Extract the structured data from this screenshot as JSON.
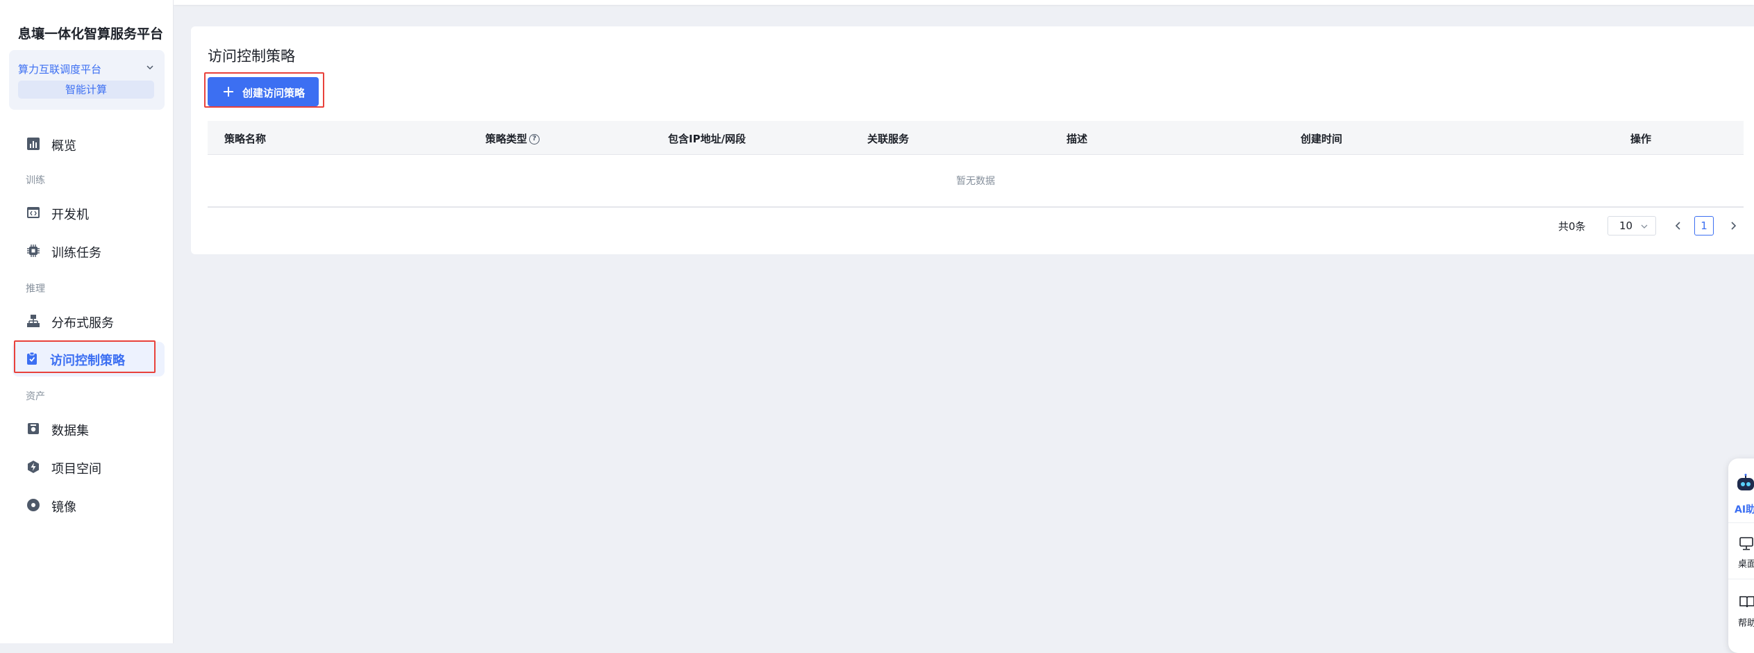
{
  "sidebar": {
    "platform_title": "息壤一体化智算服务平台",
    "switcher": {
      "name": "算力互联调度平台",
      "sub": "智能计算"
    },
    "items": [
      {
        "label": "概览"
      },
      {
        "label": "开发机"
      },
      {
        "label": "训练任务"
      },
      {
        "label": "分布式服务"
      },
      {
        "label": "访问控制策略",
        "active": true
      },
      {
        "label": "数据集"
      },
      {
        "label": "项目空间"
      },
      {
        "label": "镜像"
      }
    ],
    "groups": {
      "training": "训练",
      "inference": "推理",
      "assets": "资产"
    }
  },
  "main": {
    "title": "访问控制策略",
    "create_button": "创建访问策略",
    "table": {
      "columns": [
        "策略名称",
        "策略类型",
        "包含IP地址/网段",
        "关联服务",
        "描述",
        "创建时间",
        "操作"
      ],
      "rows": [],
      "empty_text": "暂无数据"
    },
    "pagination": {
      "total_text": "共0条",
      "page_size": "10",
      "current_page": "1"
    }
  },
  "float_panel": {
    "ai_label": "AI助",
    "desktop_label": "桌面",
    "help_label": "帮助"
  },
  "colors": {
    "accent": "#3c6ff2",
    "highlight": "#e8413b",
    "background": "#eef0f5"
  }
}
